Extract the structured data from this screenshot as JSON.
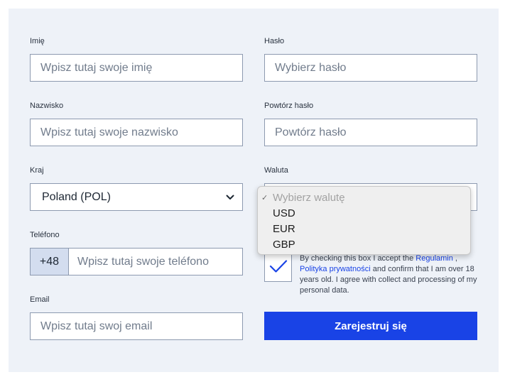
{
  "form": {
    "first_name": {
      "label": "Imię",
      "placeholder": "Wpisz tutaj swoje imię"
    },
    "last_name": {
      "label": "Nazwisko",
      "placeholder": "Wpisz tutaj swoje nazwisko"
    },
    "country": {
      "label": "Kraj",
      "value": "Poland (POL)"
    },
    "phone": {
      "label": "Teléfono",
      "prefix": "+48",
      "placeholder": "Wpisz tutaj swoje teléfono"
    },
    "email": {
      "label": "Email",
      "placeholder": "Wpisz tutaj swoj email"
    },
    "password": {
      "label": "Hasło",
      "placeholder": "Wybierz hasło"
    },
    "password_repeat": {
      "label": "Powtórz hasło",
      "placeholder": "Powtórz hasło"
    },
    "currency": {
      "label": "Waluta",
      "options": [
        "Wybierz walutę",
        "USD",
        "EUR",
        "GBP"
      ],
      "checked_mark": "✓"
    },
    "consent": {
      "text_before": "By checking this box I accept the ",
      "link_terms": "Regulamin",
      "text_sep": " , ",
      "link_privacy": "Polityka prywatności",
      "text_after": " and confirm that I am over 18 years old. I agree with collect and processing of my personal data.",
      "checked": true
    },
    "submit_label": "Zarejestruj się"
  },
  "colors": {
    "panel_bg": "#eef2f8",
    "accent": "#1943e6",
    "field_border": "#8d9ab0",
    "prefix_bg": "#d3ddef"
  }
}
